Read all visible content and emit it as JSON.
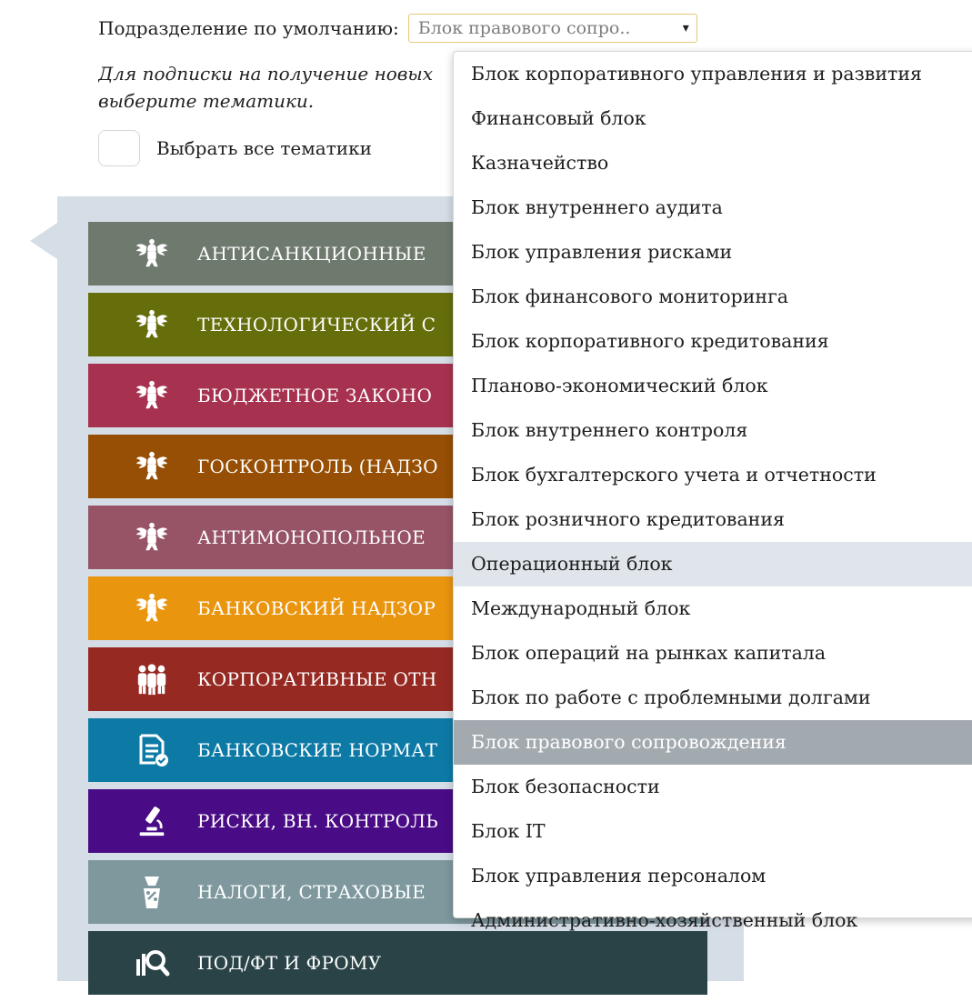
{
  "default_unit": {
    "label": "Подразделение по умолчанию:",
    "selected": "Блок правового сопро..",
    "caret": "▾"
  },
  "hint": {
    "line1": "Для подписки на получение новых",
    "line2": "выберите тематики."
  },
  "select_all": {
    "label": "Выбрать все тематики"
  },
  "topics": [
    {
      "label": "АНТИСАНКЦИОННЫЕ",
      "color": "#6f7a6e",
      "icon": "emblem-icon"
    },
    {
      "label": "ТЕХНОЛОГИЧЕСКИЙ С",
      "color": "#666e0b",
      "icon": "emblem-icon"
    },
    {
      "label": "БЮДЖЕТНОЕ ЗАКОНО",
      "color": "#a7324f",
      "icon": "emblem-icon"
    },
    {
      "label": "ГОСКОНТРОЛЬ (НАДЗО",
      "color": "#964f04",
      "icon": "emblem-icon"
    },
    {
      "label": "АНТИМОНОПОЛЬНОЕ",
      "color": "#975467",
      "icon": "emblem-icon"
    },
    {
      "label": "БАНКОВСКИЙ НАДЗОР",
      "color": "#ea950e",
      "icon": "emblem-icon"
    },
    {
      "label": "КОРПОРАТИВНЫЕ ОТН",
      "color": "#962a23",
      "icon": "people-icon"
    },
    {
      "label": "БАНКОВСКИЕ НОРМАТ",
      "color": "#0d7aa6",
      "icon": "document-check-icon"
    },
    {
      "label": "РИСКИ, ВН. КОНТРОЛЬ",
      "color": "#4a0c86",
      "icon": "microscope-icon"
    },
    {
      "label": "НАЛОГИ, СТРАХОВЫЕ",
      "color": "#7e989e",
      "icon": "tax-icon"
    },
    {
      "label": "ПОД/ФТ И ФРОМУ",
      "color": "#294347",
      "icon": "magnifier-chart-icon"
    }
  ],
  "dropdown": {
    "hovered_index": 11,
    "selected_index": 15,
    "options": [
      "Блок корпоративного управления и развития",
      "Финансовый блок",
      "Казначейство",
      "Блок внутреннего аудита",
      "Блок управления рисками",
      "Блок финансового мониторинга",
      "Блок корпоративного кредитования",
      "Планово-экономический блок",
      "Блок внутреннего контроля",
      "Блок бухгалтерского учета и отчетности",
      "Блок розничного кредитования",
      "Операционный блок",
      "Международный блок",
      "Блок операций на рынках капитала",
      "Блок по работе с проблемными долгами",
      "Блок правового сопровождения",
      "Блок безопасности",
      "Блок IT",
      "Блок управления персоналом",
      "Административно-хозяйственный блок"
    ]
  }
}
